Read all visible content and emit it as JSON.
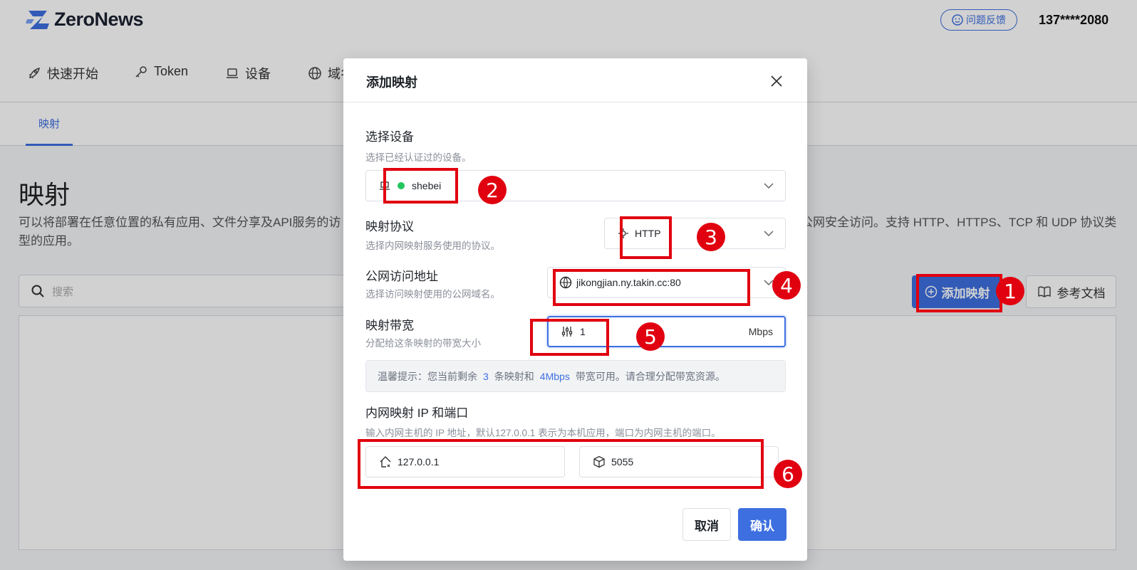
{
  "app": {
    "brand": "ZeroNews",
    "feedback_label": "问题反馈",
    "user": "137****2080"
  },
  "nav": [
    {
      "label": "快速开始",
      "icon": "rocket-icon"
    },
    {
      "label": "Token",
      "icon": "key-icon"
    },
    {
      "label": "设备",
      "icon": "laptop-icon"
    },
    {
      "label": "域名",
      "icon": "globe-icon"
    }
  ],
  "subnav": {
    "active_tab": "映射"
  },
  "page": {
    "title": "映射",
    "desc_left": "可以将部署在任意位置的私有应用、文件分享及API服务的访",
    "desc_right": "公网安全访问。支持 HTTP、HTTPS、TCP 和 UDP 协议类",
    "desc_right2": "型的应用。",
    "search_placeholder": "搜索",
    "add_button": "添加映射",
    "doc_button": "参考文档"
  },
  "modal": {
    "title": "添加映射",
    "device": {
      "label": "选择设备",
      "hint": "选择已经认证过的设备。",
      "value": "shebei",
      "status_color": "#22c55e"
    },
    "protocol": {
      "label": "映射协议",
      "hint": "选择内网映射服务使用的协议。",
      "value": "HTTP"
    },
    "domain": {
      "label": "公网访问地址",
      "hint": "选择访问映射使用的公网域名。",
      "value": "jikongjian.ny.takin.cc:80"
    },
    "bandwidth": {
      "label": "映射带宽",
      "hint": "分配给这条映射的带宽大小",
      "value": "1",
      "unit": "Mbps"
    },
    "tip": {
      "prefix": "温馨提示：您当前剩余",
      "count": "3",
      "mid": "条映射和",
      "bw": "4Mbps",
      "suffix": "带宽可用。请合理分配带宽资源。"
    },
    "target": {
      "label": "内网映射 IP 和端口",
      "hint": "输入内网主机的 IP 地址，默认127.0.0.1 表示为本机应用，端口为内网主机的端口。",
      "ip": "127.0.0.1",
      "port": "5055"
    },
    "cancel": "取消",
    "confirm": "确认"
  },
  "annotations": [
    "1",
    "2",
    "3",
    "4",
    "5",
    "6"
  ],
  "colors": {
    "accent": "#3d6fe0",
    "annotation": "#e1000f"
  }
}
